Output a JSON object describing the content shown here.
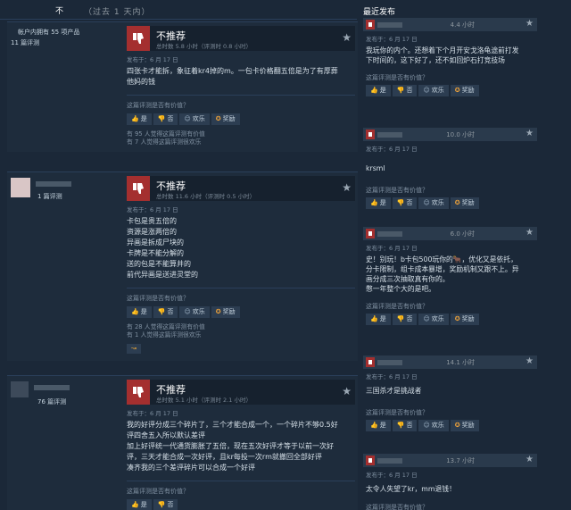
{
  "top": {
    "tab": "不",
    "range": "（过去 1 天内）"
  },
  "common": {
    "not_recommended": "不推荐",
    "helpful_q": "这篇评测是否有价值？",
    "yes": "是",
    "no": "否",
    "funny": "欢乐",
    "award": "奖励",
    "posted": "发布于：6 月 17 日"
  },
  "reviews": [
    {
      "author_line1": "帐户内拥有 55 项产品",
      "author_line2": "11 篇评测",
      "hours": "总时数 5.8 小时（评测时 0.8 小时）",
      "body": "四张卡才能拆，象征着kr4掉的m。一包卡价格翻五倍是为了有厚葬\n他妈的钱",
      "stats_1": "有 95 人觉得这篇评测有价值",
      "stats_2": "有 7 人觉得这篇评测很欢乐"
    },
    {
      "author_line1": "",
      "author_line2": "1 篇评测",
      "hours": "总时数 11.6 小时（评测时 0.5 小时）",
      "body": "卡包是贵五倍的\n资源是涨两倍的\n异画是拆成尸块的\n卡牌是不能分解的\n送的包是不能算井的\n前代异画是送进灵堂的",
      "stats_1": "有 28 人觉得这篇评测有价值",
      "stats_2": "有 1 人觉得这篇评测很欢乐",
      "award_icon": "↝"
    },
    {
      "author_line1": "",
      "author_line2": "76 篇评测",
      "hours": "总时数 5.1 小时（评测时 2.1 小时）",
      "body": "我的好评分成三个碎片了，三个才能合成一个，一个碎片不够0.5好\n评四舍五入所以默认差评\n加上好评统一代通货膨胀了五倍，现在五次好评才等于以前一次好\n评，三天才能合成一次好评，且kr每投一次rm就撤回全部好评\n凑齐我的三个差评碎片可以合成一个好评"
    }
  ],
  "recent": {
    "title": "最近发布",
    "items": [
      {
        "hours": "4.4 小时",
        "body": "我玩你的内个。还想着下个月开安戈洛龟途前打发\n下时间的，这下好了，还不如回炉石打竞技场"
      },
      {
        "hours": "10.0 小时",
        "body": "krsml"
      },
      {
        "hours": "6.0 小时",
        "body": "史！别玩！b卡包500玩你的🐂，优化又是依托，\n分卡限制，组卡成本暴增，奖励机制又跟不上。异\n画分成三次抽取真有你的。\n憋一年整个大的是吧。"
      },
      {
        "hours": "14.1 小时",
        "body": "三国杀才是挑战者"
      },
      {
        "hours": "13.7 小时",
        "body": "太令人失望了kr，mm退钱！"
      }
    ]
  }
}
